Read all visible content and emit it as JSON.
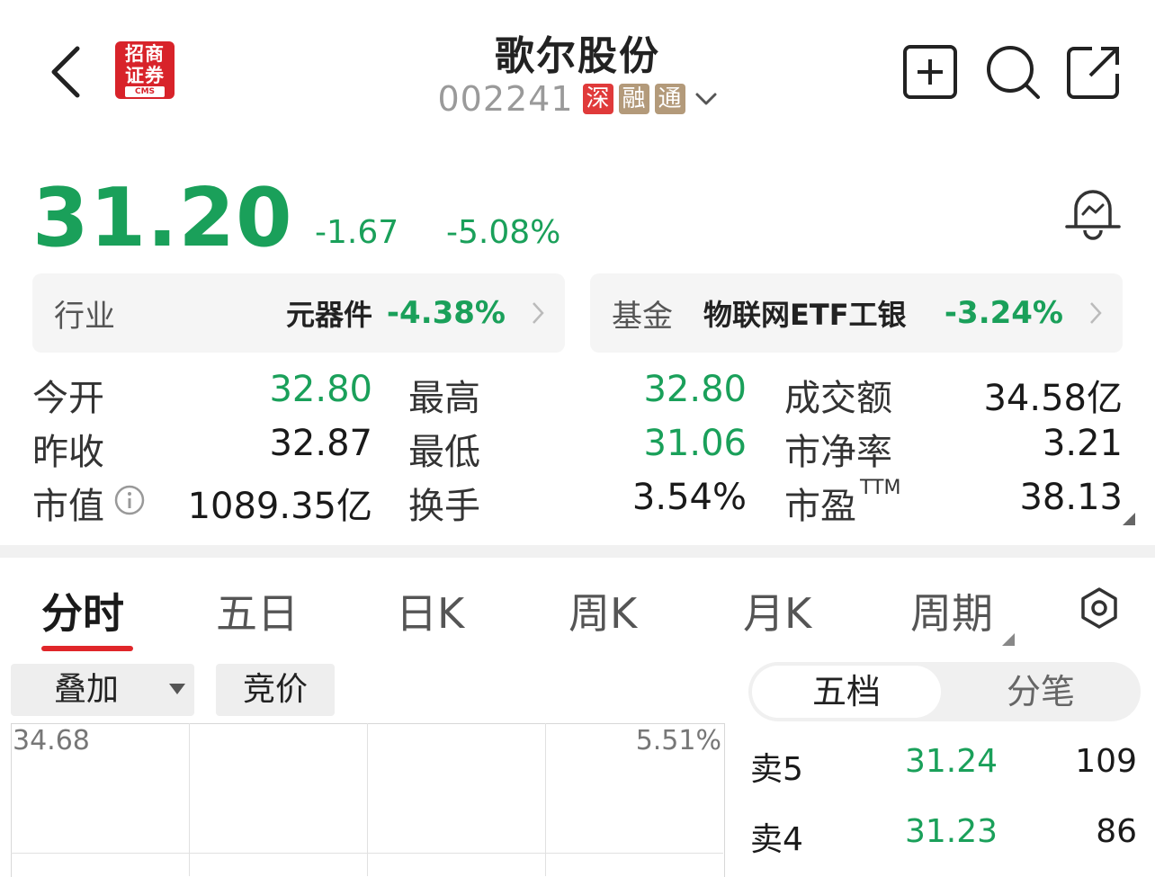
{
  "header": {
    "title": "歌尔股份",
    "code": "002241",
    "badges": [
      "深",
      "融",
      "通"
    ],
    "logo": {
      "line1": "招商",
      "line2": "证券",
      "sub": "CMS"
    }
  },
  "quote": {
    "price": "31.20",
    "change": "-1.67",
    "change_pct": "-5.08%",
    "color": "#1aa05a"
  },
  "industry": {
    "label": "行业",
    "name": "元器件",
    "pct": "-4.38%"
  },
  "fund": {
    "label": "基金",
    "name": "物联网ETF工银",
    "pct": "-3.24%"
  },
  "stats": {
    "open": {
      "label": "今开",
      "value": "32.80"
    },
    "high": {
      "label": "最高",
      "value": "32.80"
    },
    "amount": {
      "label": "成交额",
      "value": "34.58亿"
    },
    "prev_close": {
      "label": "昨收",
      "value": "32.87"
    },
    "low": {
      "label": "最低",
      "value": "31.06"
    },
    "pb": {
      "label": "市净率",
      "value": "3.21"
    },
    "mktcap": {
      "label": "市值",
      "value": "1089.35亿"
    },
    "turnover": {
      "label": "换手",
      "value": "3.54%"
    },
    "pe": {
      "label": "市盈",
      "sup": "TTM",
      "value": "38.13"
    }
  },
  "tabs": [
    "分时",
    "五日",
    "日K",
    "周K",
    "月K",
    "周期"
  ],
  "controls": {
    "overlay": "叠加",
    "auction": "竞价"
  },
  "segment": {
    "left": "五档",
    "right": "分笔"
  },
  "chart": {
    "top_price": "34.68",
    "top_pct": "5.51%"
  },
  "orderbook": [
    {
      "label": "卖5",
      "price": "31.24",
      "vol": "109"
    },
    {
      "label": "卖4",
      "price": "31.23",
      "vol": "86"
    }
  ]
}
